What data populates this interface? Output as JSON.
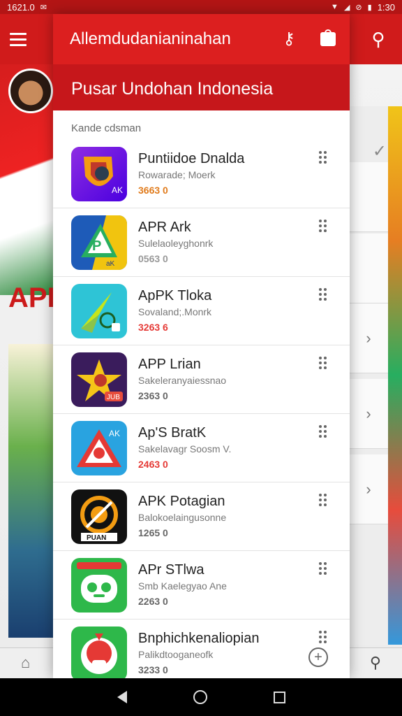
{
  "status_bar": {
    "time": "1621.0",
    "battery_text": "1:30"
  },
  "app_bar": {
    "menu_icon": "hamburger-menu-icon",
    "search_icon": "search-icon"
  },
  "drawer": {
    "title": "Allemdudanianinahan",
    "key_icon": "key-icon",
    "bag_icon": "shopping-bag-icon",
    "subheader": "Pusar Undohan Indonesia",
    "section_label": "Kande cdsman",
    "apps": [
      {
        "name": "Puntiidoe Dnalda",
        "subtitle": "Rowarade; Moerk",
        "size": "3663 0",
        "size_color": "#e07b1c",
        "icon": "shield-app-icon"
      },
      {
        "name": "APR Ark",
        "subtitle": "Sulelaoleyghonrk",
        "size": "0563 0",
        "size_color": "#999999",
        "icon": "pk-app-icon"
      },
      {
        "name": "ApPK Tloka",
        "subtitle": "Sovaland;.Monrk",
        "size": "3263 6",
        "size_color": "#e53935",
        "icon": "arrow-app-icon"
      },
      {
        "name": "APP Lrian",
        "subtitle": "Sakeleranyaiessnao",
        "size": "2363 0",
        "size_color": "#666666",
        "icon": "star-app-icon"
      },
      {
        "name": "Ap'S BratK",
        "subtitle": "Sakelavagr Soosm V.",
        "size": "2463 0",
        "size_color": "#e53935",
        "icon": "triangle-app-icon"
      },
      {
        "name": "APK Potagian",
        "subtitle": "Balokoelaingusonne",
        "size": "1265 0",
        "size_color": "#666666",
        "icon": "target-app-icon"
      },
      {
        "name": "APr STlwa",
        "subtitle": "Smb Kaelegyao Ane",
        "size": "2263 0",
        "size_color": "#666666",
        "icon": "robot-app-icon"
      },
      {
        "name": "Bnphichkenaliopian",
        "subtitle": "Palikdtooganeofk",
        "size": "3233 0",
        "size_color": "#666666",
        "icon": "mascot-app-icon"
      }
    ]
  },
  "background": {
    "apk_text": "APK"
  },
  "add_icon": "add-circle-icon",
  "bottom_nav": {
    "home_icon": "home-icon",
    "search_icon": "search-icon"
  },
  "system_nav": {
    "back": "back-icon",
    "home": "home-circle-icon",
    "recents": "recents-icon"
  }
}
